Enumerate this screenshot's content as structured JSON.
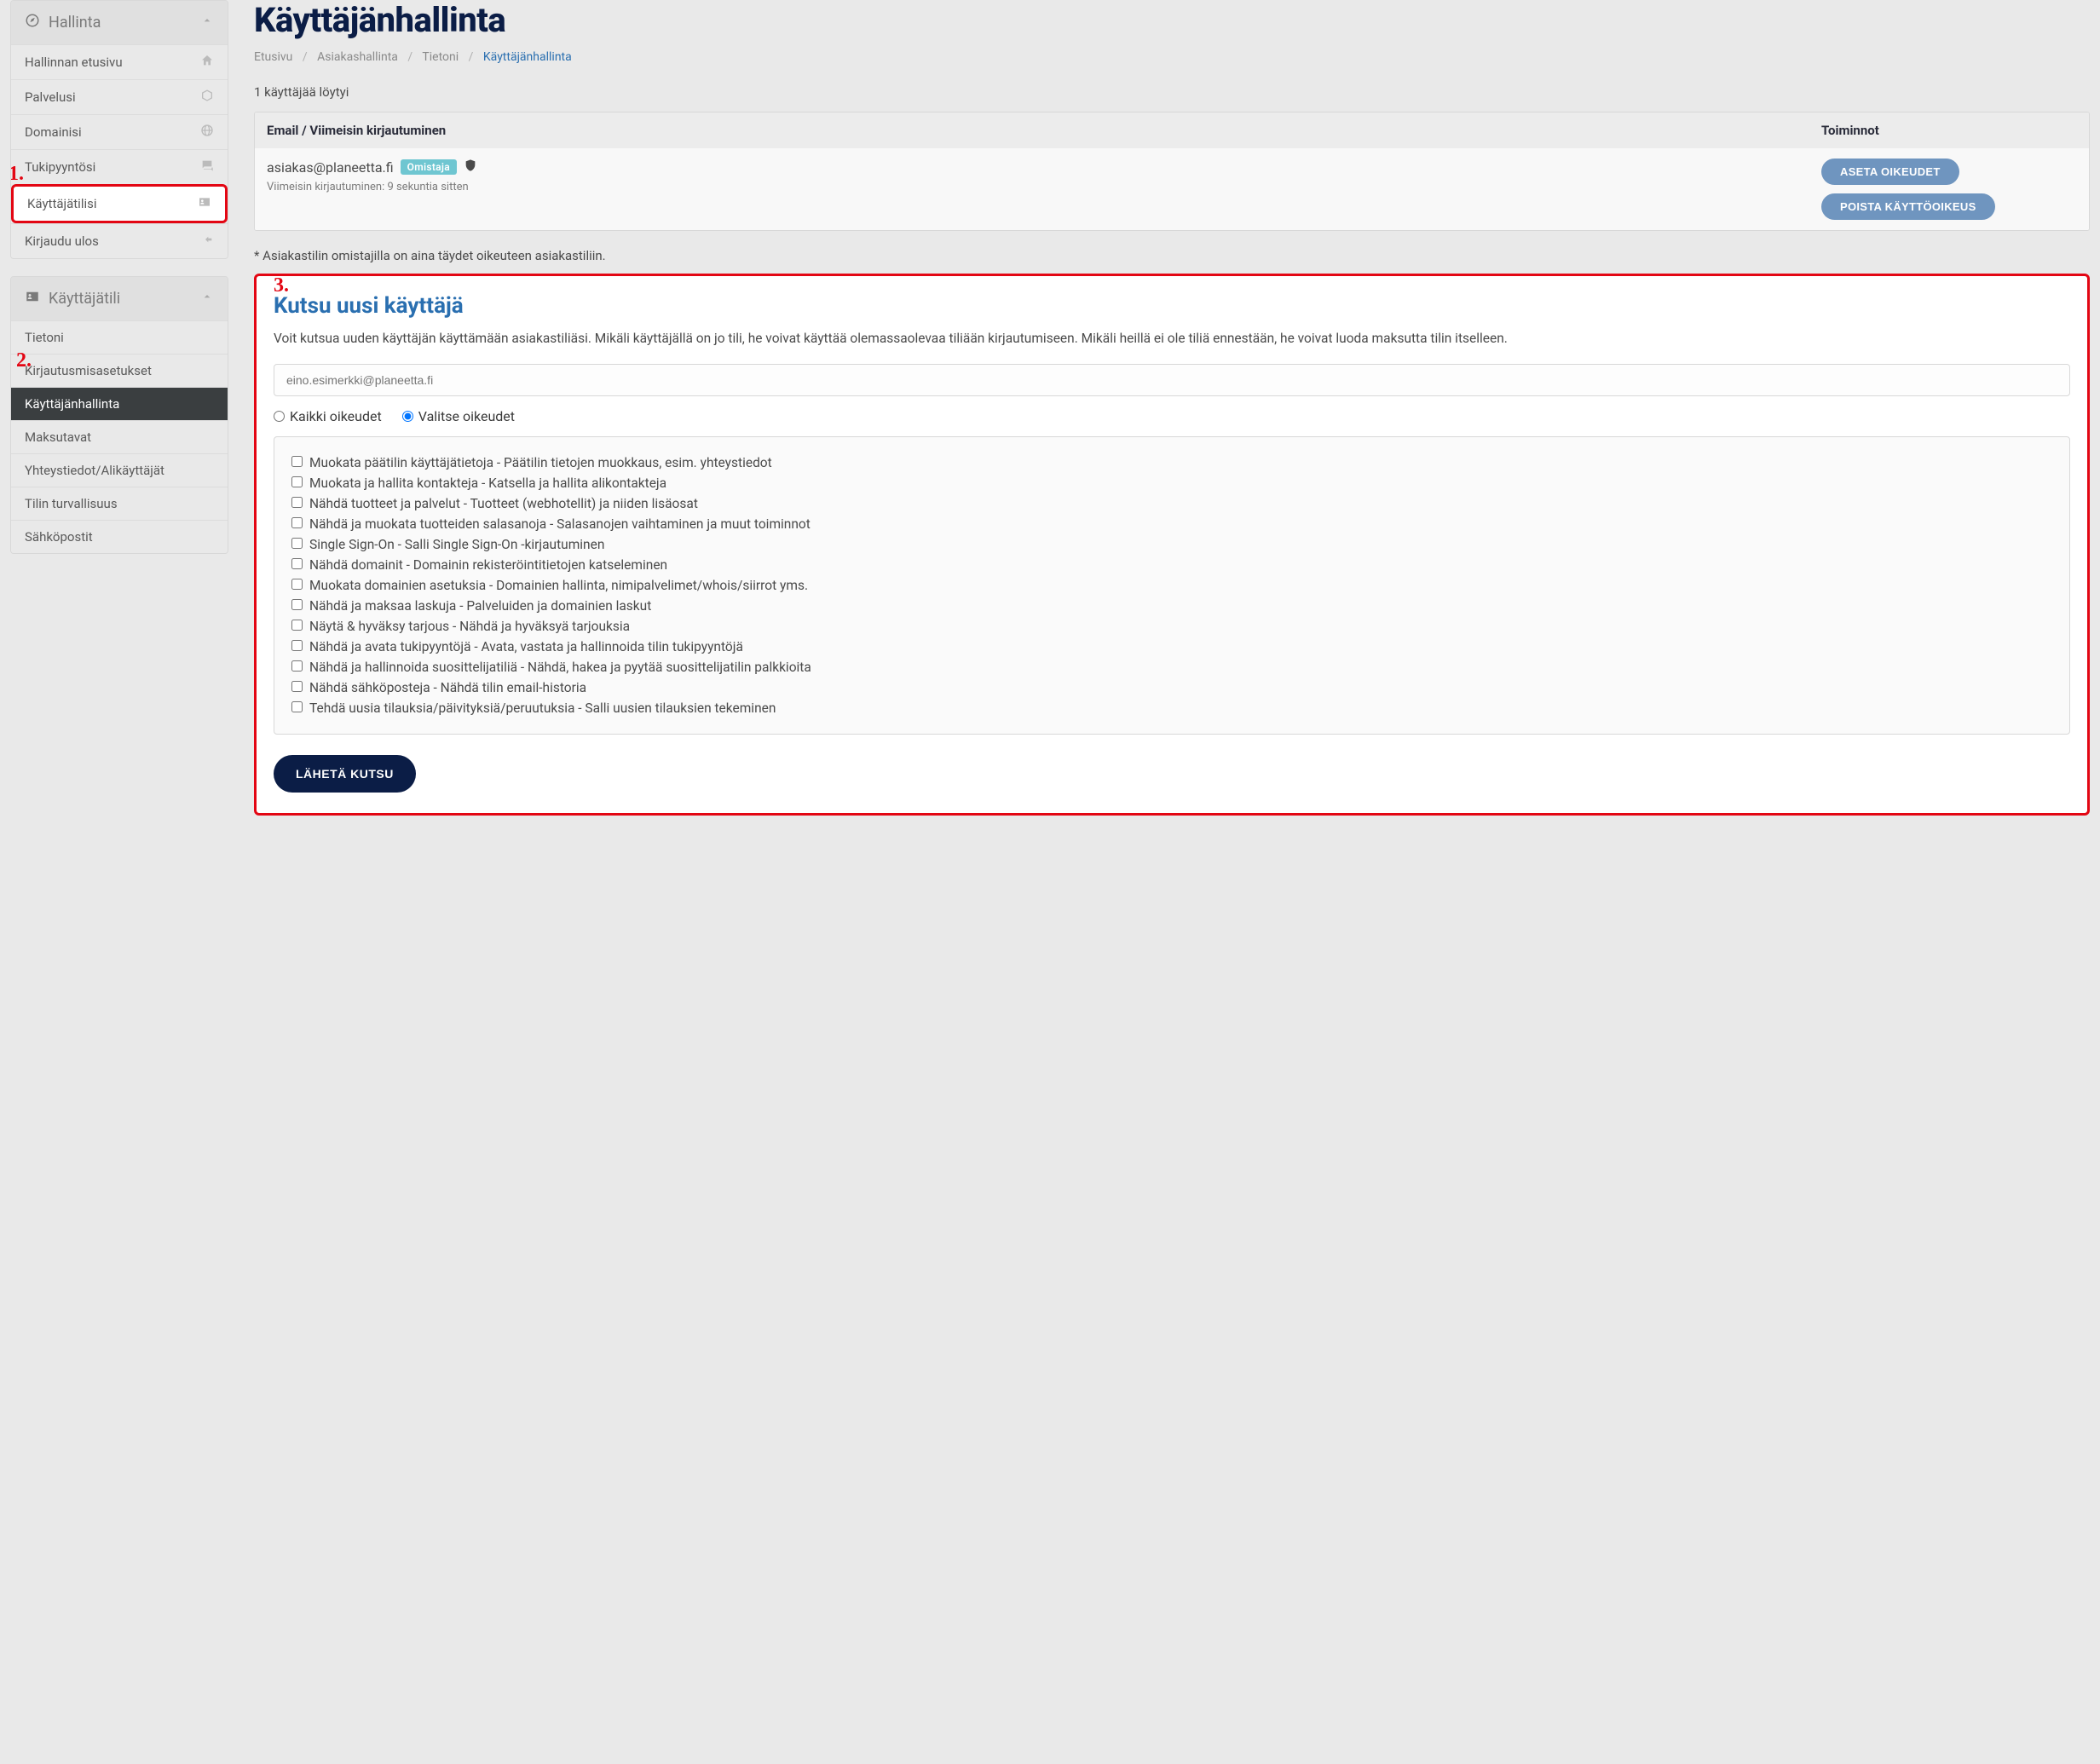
{
  "annotations": {
    "n1": "1.",
    "n2": "2.",
    "n3": "3."
  },
  "sidebar": {
    "section1": {
      "title": "Hallinta",
      "items": [
        {
          "label": "Hallinnan etusivu"
        },
        {
          "label": "Palvelusi"
        },
        {
          "label": "Domainisi"
        },
        {
          "label": "Tukipyyntösi"
        },
        {
          "label": "Käyttäjätilisi"
        },
        {
          "label": "Kirjaudu ulos"
        }
      ]
    },
    "section2": {
      "title": "Käyttäjätili",
      "items": [
        {
          "label": "Tietoni"
        },
        {
          "label": "Kirjautusmisasetukset"
        },
        {
          "label": "Käyttäjänhallinta"
        },
        {
          "label": "Maksutavat"
        },
        {
          "label": "Yhteystiedot/Alikäyttäjät"
        },
        {
          "label": "Tilin turvallisuus"
        },
        {
          "label": "Sähköpostit"
        }
      ]
    }
  },
  "main": {
    "page_title": "Käyttäjänhallinta",
    "breadcrumb": {
      "b0": "Etusivu",
      "b1": "Asiakashallinta",
      "b2": "Tietoni",
      "b3": "Käyttäjänhallinta"
    },
    "found": "1 käyttäjää löytyi",
    "table": {
      "th_left": "Email / Viimeisin kirjautuminen",
      "th_right": "Toiminnot",
      "row": {
        "email": "asiakas@planeetta.fi",
        "owner_badge": "Omistaja",
        "last_login": "Viimeisin kirjautuminen: 9 sekuntia sitten",
        "btn_rights": "ASETA OIKEUDET",
        "btn_remove": "POISTA KÄYTTÖOIKEUS"
      }
    },
    "note": "* Asiakastilin omistajilla on aina täydet oikeuteen asiakastiliin.",
    "invite": {
      "title": "Kutsu uusi käyttäjä",
      "desc": "Voit kutsua uuden käyttäjän käyttämään asiakastiliäsi. Mikäli käyttäjällä on jo tili, he voivat käyttää olemassaolevaa tiliään kirjautumiseen. Mikäli heillä ei ole tiliä ennestään, he voivat luoda maksutta tilin itselleen.",
      "email_placeholder": "eino.esimerkki@planeetta.fi",
      "radio_all": "Kaikki oikeudet",
      "radio_select": "Valitse oikeudet",
      "perms": [
        "Muokata päätilin käyttäjätietoja - Päätilin tietojen muokkaus, esim. yhteystiedot",
        "Muokata ja hallita kontakteja - Katsella ja hallita alikontakteja",
        "Nähdä tuotteet ja palvelut - Tuotteet (webhotellit) ja niiden lisäosat",
        "Nähdä ja muokata tuotteiden salasanoja - Salasanojen vaihtaminen ja muut toiminnot",
        "Single Sign-On - Salli Single Sign-On -kirjautuminen",
        "Nähdä domainit - Domainin rekisteröintitietojen katseleminen",
        "Muokata domainien asetuksia - Domainien hallinta, nimipalvelimet/whois/siirrot yms.",
        "Nähdä ja maksaa laskuja - Palveluiden ja domainien laskut",
        "Näytä & hyväksy tarjous - Nähdä ja hyväksyä tarjouksia",
        "Nähdä ja avata tukipyyntöjä - Avata, vastata ja hallinnoida tilin tukipyyntöjä",
        "Nähdä ja hallinnoida suosittelijatiliä - Nähdä, hakea ja pyytää suosittelijatilin palkkioita",
        "Nähdä sähköposteja - Nähdä tilin email-historia",
        "Tehdä uusia tilauksia/päivityksiä/peruutuksia - Salli uusien tilauksien tekeminen"
      ],
      "submit": "LÄHETÄ KUTSU"
    }
  }
}
